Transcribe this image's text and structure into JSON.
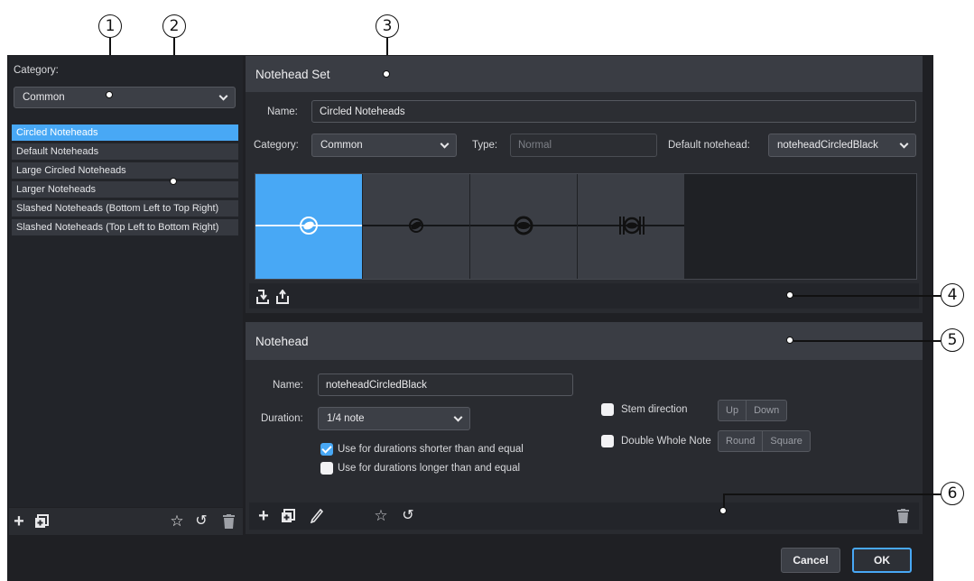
{
  "callouts": [
    "1",
    "2",
    "3",
    "4",
    "5",
    "6"
  ],
  "left": {
    "category_label": "Category:",
    "category_value": "Common",
    "sets": [
      "Circled Noteheads",
      "Default Noteheads",
      "Large Circled Noteheads",
      "Larger Noteheads",
      "Slashed Noteheads (Bottom Left to Top Right)",
      "Slashed Noteheads (Top Left to Bottom Right)"
    ],
    "selected_index": 0
  },
  "set_panel": {
    "title": "Notehead Set",
    "name_label": "Name:",
    "name_value": "Circled Noteheads",
    "category_label": "Category:",
    "category_value": "Common",
    "type_label": "Type:",
    "type_value": "Normal",
    "default_label": "Default notehead:",
    "default_value": "noteheadCircledBlack",
    "preview_count": 4
  },
  "notehead_panel": {
    "title": "Notehead",
    "name_label": "Name:",
    "name_value": "noteheadCircledBlack",
    "duration_label": "Duration:",
    "duration_value": "1/4 note",
    "shorter_label": "Use for durations shorter than and equal",
    "shorter_checked": true,
    "longer_label": "Use for durations longer than and equal",
    "longer_checked": false,
    "stem_label": "Stem direction",
    "stem_options": [
      "Up",
      "Down"
    ],
    "double_label": "Double Whole Note",
    "double_options": [
      "Round",
      "Square"
    ]
  },
  "footer": {
    "cancel": "Cancel",
    "ok": "OK"
  },
  "colors": {
    "accent": "#48a8f5",
    "background": "#1f2024",
    "panel": "#292b30"
  }
}
